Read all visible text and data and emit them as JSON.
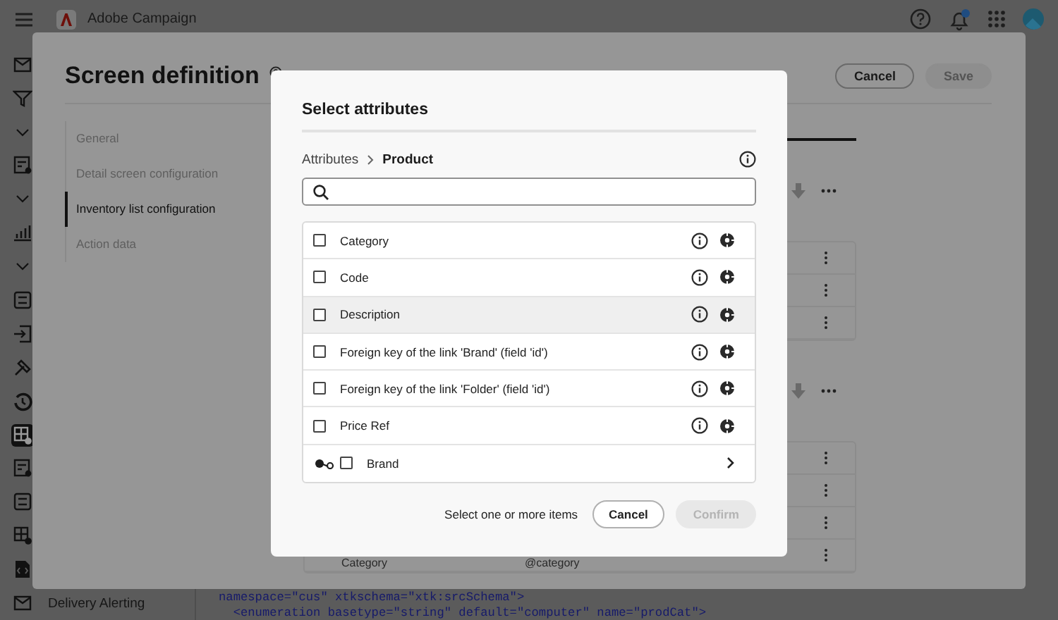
{
  "app": {
    "title": "Adobe Campaign"
  },
  "sidebar": {
    "items": [
      {
        "kind": "inbox",
        "selected": false
      },
      {
        "kind": "filter",
        "selected": false
      },
      {
        "kind": "chevron",
        "selected": false
      },
      {
        "kind": "form",
        "selected": false
      },
      {
        "kind": "chevron",
        "selected": false
      },
      {
        "kind": "chart",
        "selected": false
      },
      {
        "kind": "chevron",
        "selected": false
      },
      {
        "kind": "list",
        "selected": false
      },
      {
        "kind": "import",
        "selected": false
      },
      {
        "kind": "tool",
        "selected": false
      },
      {
        "kind": "history",
        "selected": false
      },
      {
        "kind": "grid",
        "selected": true
      },
      {
        "kind": "form",
        "selected": false
      },
      {
        "kind": "list",
        "selected": false
      },
      {
        "kind": "grid",
        "selected": false
      },
      {
        "kind": "code",
        "selected": false
      },
      {
        "kind": "inbox",
        "selected": false,
        "label": "Delivery Alerting"
      }
    ]
  },
  "code_lines": [
    "namespace=\"cus\" xtkschema=\"xtk:srcSchema\">",
    "  <enumeration basetype=\"string\" default=\"computer\" name=\"prodCat\">"
  ],
  "screen_definition": {
    "title": "Screen definition",
    "buttons": [
      {
        "label": "Cancel",
        "disabled": false
      },
      {
        "label": "Save",
        "disabled": true
      }
    ],
    "nav": [
      {
        "label": "General",
        "selected": false
      },
      {
        "label": "Detail screen configuration",
        "selected": false
      },
      {
        "label": "Inventory list configuration",
        "selected": true
      },
      {
        "label": "Action data",
        "selected": false
      }
    ],
    "last_row": [
      "Category",
      "@category"
    ]
  },
  "dialog": {
    "title": "Select attributes",
    "breadcrumb": [
      {
        "label": "Attributes",
        "current": false
      },
      {
        "label": "Product",
        "current": true
      }
    ],
    "items": [
      {
        "kind": "field",
        "label": "Category",
        "checked": false,
        "hovered": false
      },
      {
        "kind": "field",
        "label": "Code",
        "checked": false,
        "hovered": false
      },
      {
        "kind": "field",
        "label": "Description",
        "checked": false,
        "hovered": true
      },
      {
        "kind": "field",
        "label": "Foreign key of the link 'Brand' (field 'id')",
        "checked": false,
        "hovered": false
      },
      {
        "kind": "field",
        "label": "Foreign key of the link 'Folder' (field 'id')",
        "checked": false,
        "hovered": false
      },
      {
        "kind": "field",
        "label": "Price Ref",
        "checked": false,
        "hovered": false
      },
      {
        "kind": "link",
        "label": "Brand",
        "checked": false,
        "hovered": false
      }
    ],
    "hint": "Select one or more items",
    "buttons": [
      {
        "label": "Cancel",
        "disabled": false
      },
      {
        "label": "Confirm",
        "disabled": true
      }
    ]
  }
}
